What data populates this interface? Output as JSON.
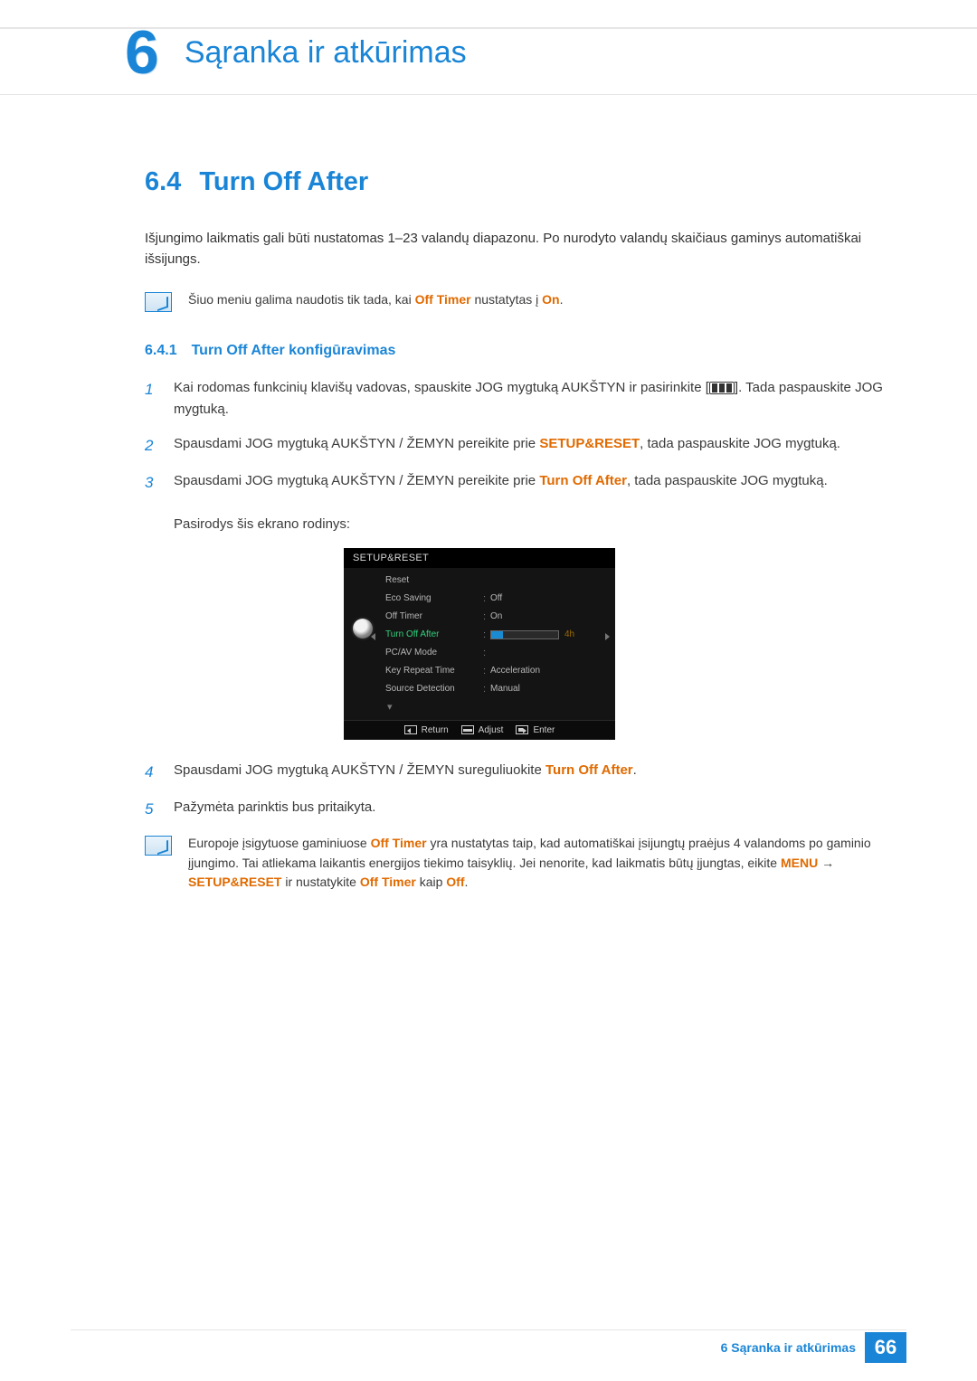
{
  "chapter": {
    "number": "6",
    "title": "Sąranka ir atkūrimas"
  },
  "section": {
    "number": "6.4",
    "title": "Turn Off After"
  },
  "intro": "Išjungimo laikmatis gali būti nustatomas 1–23 valandų diapazonu. Po nurodyto valandų skaičiaus gaminys automatiškai išsijungs.",
  "note1": {
    "pre": "Šiuo meniu galima naudotis tik tada, kai ",
    "hl1": "Off Timer",
    "mid": " nustatytas į ",
    "hl2": "On",
    "post": "."
  },
  "subsection": {
    "number": "6.4.1",
    "title": "Turn Off After konfigūravimas"
  },
  "steps": {
    "s1a": "Kai rodomas funkcinių klavišų vadovas, spauskite JOG mygtuką AUKŠTYN ir pasirinkite [",
    "s1b": "]. Tada paspauskite JOG mygtuką.",
    "s2a": "Spausdami JOG mygtuką AUKŠTYN / ŽEMYN pereikite prie ",
    "s2hl": "SETUP&RESET",
    "s2b": ", tada paspauskite JOG mygtuką.",
    "s3a": "Spausdami JOG mygtuką AUKŠTYN / ŽEMYN pereikite prie ",
    "s3hl": "Turn Off After",
    "s3b": ", tada paspauskite JOG mygtuką.",
    "s3c": "Pasirodys šis ekrano rodinys:",
    "s4a": "Spausdami JOG mygtuką AUKŠTYN / ŽEMYN sureguliuokite ",
    "s4hl": "Turn Off After",
    "s4b": ".",
    "s5": "Pažymėta parinktis bus pritaikyta."
  },
  "osd": {
    "title": "SETUP&RESET",
    "rows": [
      {
        "label": "Reset",
        "val": ""
      },
      {
        "label": "Eco Saving",
        "val": "Off"
      },
      {
        "label": "Off Timer",
        "val": "On"
      },
      {
        "label": "Turn Off After",
        "val": "4h",
        "selected": true
      },
      {
        "label": "PC/AV Mode",
        "val": ""
      },
      {
        "label": "Key Repeat Time",
        "val": "Acceleration"
      },
      {
        "label": "Source Detection",
        "val": "Manual"
      }
    ],
    "footer": {
      "return": "Return",
      "adjust": "Adjust",
      "enter": "Enter"
    }
  },
  "note2": {
    "t1": "Europoje įsigytuose gaminiuose ",
    "h1": "Off Timer",
    "t2": " yra nustatytas taip, kad automatiškai įsijungtų praėjus 4 valandoms po gaminio įjungimo. Tai atliekama laikantis energijos tiekimo taisyklių. Jei nenorite, kad laikmatis būtų įjungtas, eikite ",
    "h2": "MENU",
    "arrow": " → ",
    "h3": "SETUP&RESET",
    "t3": " ir nustatykite ",
    "h4": "Off Timer",
    "t4": " kaip ",
    "h5": "Off",
    "t5": "."
  },
  "footer": {
    "text": "6 Sąranka ir atkūrimas",
    "page": "66"
  },
  "nums": {
    "n1": "1",
    "n2": "2",
    "n3": "3",
    "n4": "4",
    "n5": "5"
  }
}
